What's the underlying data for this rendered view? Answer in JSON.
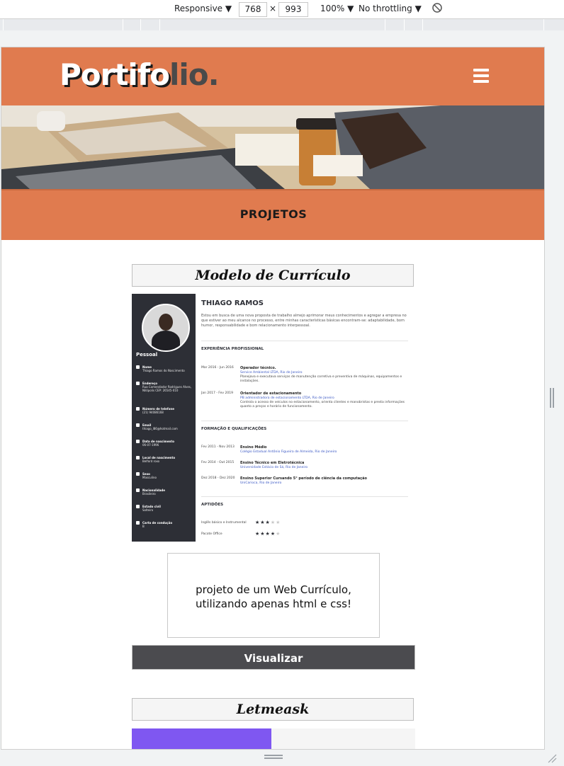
{
  "devtools": {
    "device": "Responsive",
    "width": "768",
    "times": "×",
    "height": "993",
    "zoom": "100%",
    "throttling": "No throttling"
  },
  "site": {
    "logo_part1": "Portifo",
    "logo_part2": "lio.",
    "section_title": "PROJETOS",
    "projects": [
      {
        "title": "Modelo de Currículo",
        "description_line1": "projeto de um Web Currículo,",
        "description_line2": "utilizando apenas html e css!",
        "button": "Visualizar"
      },
      {
        "title": "Letmeask"
      }
    ]
  },
  "resume": {
    "name": "THIAGO RAMOS",
    "intro": "Estou em busca de uma nova proposta de trabalho almejo aprimorar meus conhecimentos e agregar a empresa no que estiver ao meu alcance no processo, entre minhas características básicas encontram-se: adaptabilidade, bom humor, responsabilidade e bom relacionamento interpessoal.",
    "sidebar_title": "Pessoal",
    "sidebar": [
      {
        "label": "Nome",
        "value": "Thiago Ramos do Nascimento"
      },
      {
        "label": "Endereço",
        "value": "Rua Comendador Rodrigues Alves, Nilópolis CEP: 26545-010"
      },
      {
        "label": "Número de telefone",
        "value": "(21) 94086168"
      },
      {
        "label": "Email",
        "value": "thiago_l86@hotmail.com"
      },
      {
        "label": "Data de nascimento",
        "value": "06-07-1996"
      },
      {
        "label": "Local de nascimento",
        "value": "Belford roxo"
      },
      {
        "label": "Sexo",
        "value": "Masculino"
      },
      {
        "label": "Nacionalidade",
        "value": "Brasileiro"
      },
      {
        "label": "Estado civil",
        "value": "Solteiro"
      },
      {
        "label": "Carta de condução",
        "value": "B"
      }
    ],
    "exp_title": "EXPERIÊNCIA PROFISSIONAL",
    "experience": [
      {
        "date": "Mar 2016 - Jun 2016",
        "role": "Operador técnico.",
        "org": "Service Ambiental LTDA, Rio de Janeiro",
        "desc": "Planejava e executava serviços de manutenção corretiva e preventiva de máquinas, equipamentos e instalações."
      },
      {
        "date": "Jan 2017 - Fev 2019",
        "role": "Orientador de estacionamento",
        "org": "PB administradora de estacionamento LTDA, Rio de Janeiro",
        "desc": "Controla o acesso de veículos no estacionamento, orienta clientes e manobristas e presta informações quanto a preços e horário de funcionamento."
      }
    ],
    "edu_title": "FORMAÇÃO E QUALIFICAÇÕES",
    "education": [
      {
        "date": "Fev 2011 - Nov 2013",
        "course": "Ensino Médio",
        "org": "Colégio Estadual Antônio Figueira de Almeida, Rio de Janeiro"
      },
      {
        "date": "Fev 2014 - Out 2015",
        "course": "Ensino Técnico em Eletrotécnica",
        "org": "Universidade Estácio de Sá, Rio de Janeiro"
      },
      {
        "date": "Dez 2018 - Dez 2020",
        "course": "Ensino Superior Cursando 5° período de ciência da computação",
        "org": "UniCarioca, Rio de Janeiro"
      }
    ],
    "skills_title": "APTIDÕES",
    "skills": [
      {
        "name": "Inglês básico e Instrumental",
        "rating": 3
      },
      {
        "name": "Pacote Office",
        "rating": 4
      }
    ]
  }
}
